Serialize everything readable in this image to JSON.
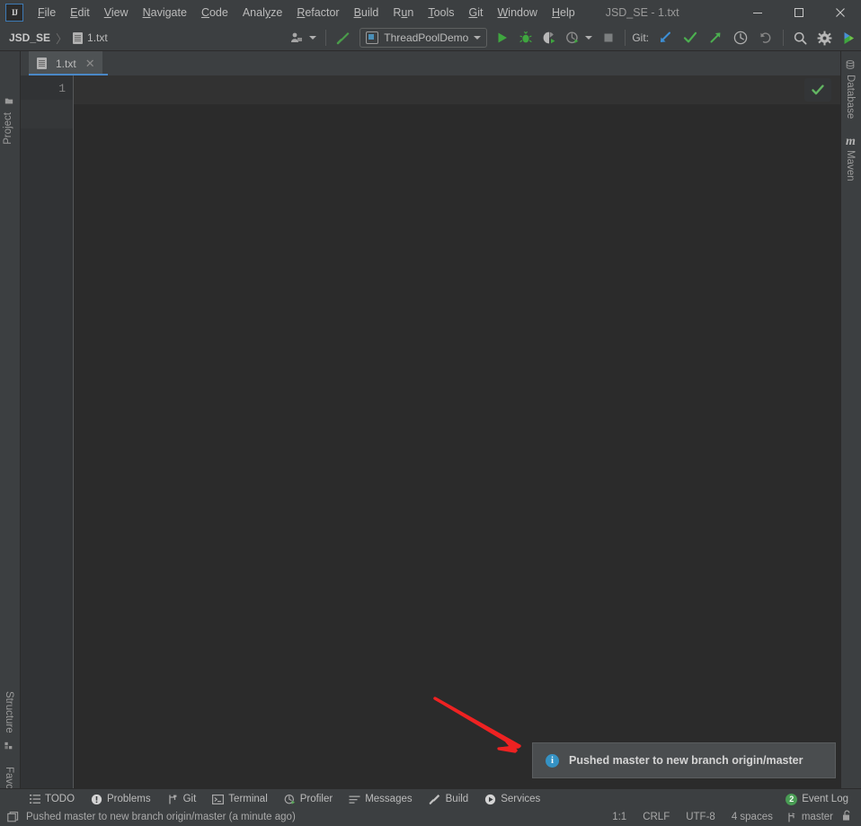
{
  "window": {
    "title": "JSD_SE - 1.txt",
    "logo_text": "IJ",
    "controls": {
      "minimize": "minimize-icon",
      "maximize": "maximize-icon",
      "close": "close-icon"
    }
  },
  "menu": {
    "items": [
      {
        "label": "File",
        "mnemonic": "F"
      },
      {
        "label": "Edit",
        "mnemonic": "E"
      },
      {
        "label": "View",
        "mnemonic": "V"
      },
      {
        "label": "Navigate",
        "mnemonic": "N"
      },
      {
        "label": "Code",
        "mnemonic": "C"
      },
      {
        "label": "Analyze",
        "mnemonic": "y"
      },
      {
        "label": "Refactor",
        "mnemonic": "R"
      },
      {
        "label": "Build",
        "mnemonic": "B"
      },
      {
        "label": "Run",
        "mnemonic": "u"
      },
      {
        "label": "Tools",
        "mnemonic": "T"
      },
      {
        "label": "Git",
        "mnemonic": "G"
      },
      {
        "label": "Window",
        "mnemonic": "W"
      },
      {
        "label": "Help",
        "mnemonic": "H"
      }
    ]
  },
  "toolbar": {
    "breadcrumb": {
      "project": "JSD_SE",
      "separator": "〉",
      "file": "1.txt"
    },
    "run_config": {
      "label": "ThreadPoolDemo",
      "dropdown": "chevron-down-icon"
    },
    "git_label": "Git:",
    "actions": [
      "user-settings-icon",
      "hammer-build-icon",
      "run-icon",
      "debug-icon",
      "run-coverage-icon",
      "profile-icon",
      "stop-icon",
      "git-update-icon",
      "git-commit-icon",
      "git-push-icon",
      "git-history-icon",
      "git-rollback-icon",
      "search-everywhere-icon",
      "settings-gear-icon",
      "ide-assistant-icon"
    ]
  },
  "left_stripe": {
    "top": [
      {
        "label": "Project",
        "icon": "folder-icon"
      }
    ],
    "bottom": [
      {
        "label": "Structure",
        "icon": "structure-icon"
      },
      {
        "label": "Favorites",
        "icon": "star-icon"
      }
    ]
  },
  "right_stripe": {
    "items": [
      {
        "label": "Database",
        "icon": "database-icon"
      },
      {
        "label": "Maven",
        "icon": "maven-icon"
      }
    ]
  },
  "editor": {
    "tab": {
      "label": "1.txt",
      "icon": "text-file-icon",
      "close": "close-icon"
    },
    "line_numbers": [
      "1"
    ],
    "content": "",
    "inspection_status": "check-icon"
  },
  "notification": {
    "icon": "info-icon",
    "message": "Pushed master to new branch origin/master"
  },
  "annotation": {
    "arrow_color": "#ee2222"
  },
  "tool_window_bar": {
    "items": [
      {
        "label": "TODO",
        "icon": "todo-list-icon"
      },
      {
        "label": "Problems",
        "icon": "problems-icon"
      },
      {
        "label": "Git",
        "icon": "git-branch-icon"
      },
      {
        "label": "Terminal",
        "icon": "terminal-icon"
      },
      {
        "label": "Profiler",
        "icon": "profiler-icon"
      },
      {
        "label": "Messages",
        "icon": "messages-icon"
      },
      {
        "label": "Build",
        "icon": "build-hammer-icon"
      },
      {
        "label": "Services",
        "icon": "services-icon"
      }
    ],
    "event_log": {
      "label": "Event Log",
      "count": "2"
    }
  },
  "status_bar": {
    "icon": "status-popup-icon",
    "message": "Pushed master to new branch origin/master (a minute ago)",
    "caret_position": "1:1",
    "line_separator": "CRLF",
    "encoding": "UTF-8",
    "indent": "4 spaces",
    "branch": {
      "label": "master",
      "icon": "git-branch-icon"
    },
    "lock": "unlocked-icon"
  },
  "colors": {
    "accent_blue": "#4a88c7",
    "editor_bg": "#2b2b2b",
    "chrome_bg": "#3c3f41",
    "gutter_bg": "#313335",
    "green": "#499c54",
    "info_blue": "#3592c4",
    "arrow_red": "#ee2222"
  }
}
